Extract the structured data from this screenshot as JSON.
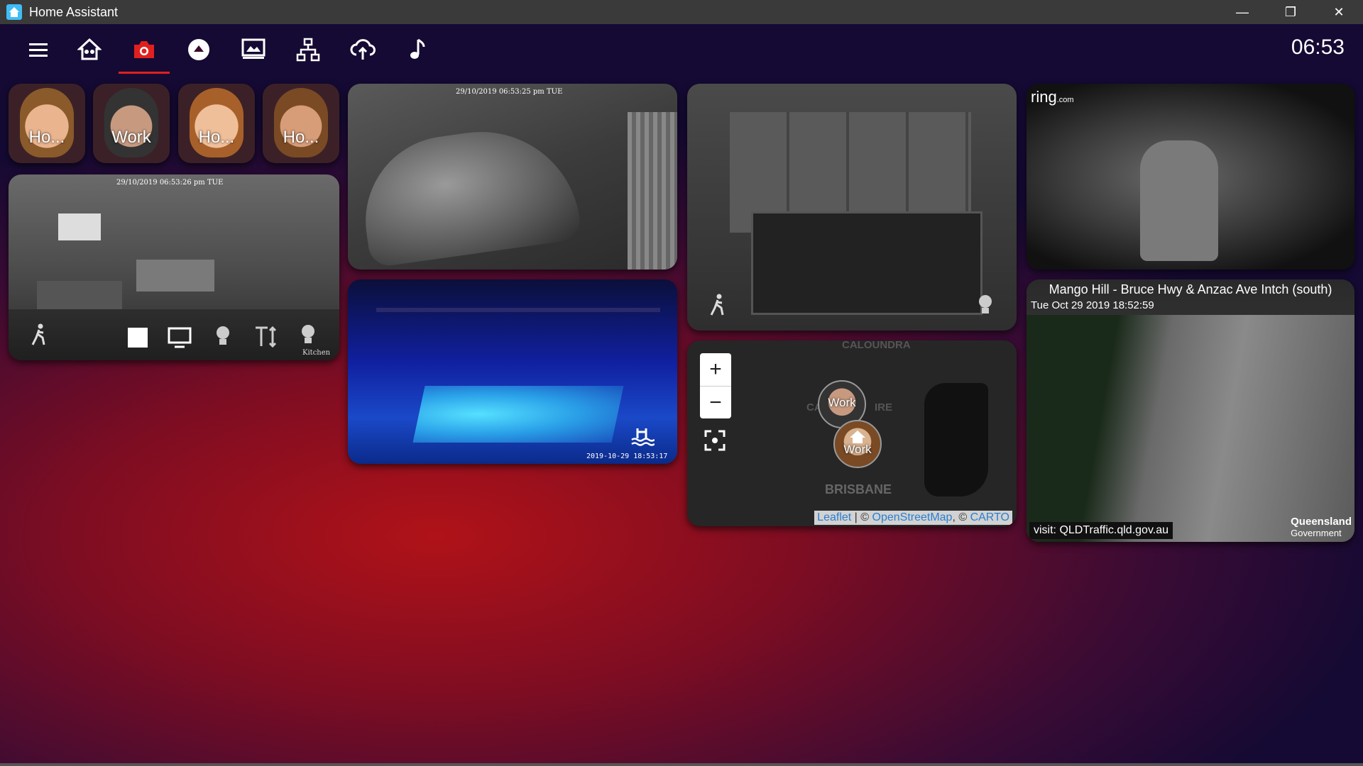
{
  "window": {
    "title": "Home Assistant",
    "minimize": "—",
    "restore": "❐",
    "close": "✕"
  },
  "toolbar": {
    "clock": "06:53",
    "icons": [
      "menu-icon",
      "home-group-icon",
      "camera-icon",
      "eject-icon",
      "presentation-icon",
      "network-icon",
      "cloud-sync-icon",
      "music-note-icon"
    ],
    "active_index": 2,
    "accent": "#e0201f"
  },
  "persons": [
    {
      "label": "Ho...",
      "hair": "#8a5a2b",
      "skin": "#e9b48e"
    },
    {
      "label": "Work",
      "hair": "#333333",
      "skin": "#c79a80"
    },
    {
      "label": "Ho...",
      "hair": "#a8602a",
      "skin": "#efbf9a"
    },
    {
      "label": "Ho...",
      "hair": "#7a4a24",
      "skin": "#d79d78"
    }
  ],
  "cameras": {
    "living": {
      "stamp": "29/10/2019 06:53:26 pm TUE",
      "corner_label": "Kitchen"
    },
    "driveway": {
      "stamp": "29/10/2019 06:53:25 pm TUE"
    },
    "pool": {
      "stamp": "2019-10-29 18:53:17"
    },
    "doorbell": {
      "brand": "ring",
      "brand_suffix": ".com"
    },
    "traffic": {
      "title": "Mango Hill - Bruce Hwy & Anzac Ave Intch (south)",
      "date": "Tue Oct 29 2019 18:52:59",
      "visit": "visit: QLDTraffic.qld.gov.au",
      "logo_line1": "Queensland",
      "logo_line2": "Government"
    }
  },
  "map": {
    "zoom_in": "+",
    "zoom_out": "−",
    "place_top": "CALOUNDRA",
    "place_bottom": "BRISBANE",
    "place_partial_left": "CA",
    "place_partial_right": "IRE",
    "markers": [
      {
        "label": "Work"
      },
      {
        "label": "Work"
      }
    ],
    "attribution": {
      "leaflet": "Leaflet",
      "sep1": " | © ",
      "osm": "OpenStreetMap",
      "sep2": ", © ",
      "carto": "CARTO"
    }
  }
}
